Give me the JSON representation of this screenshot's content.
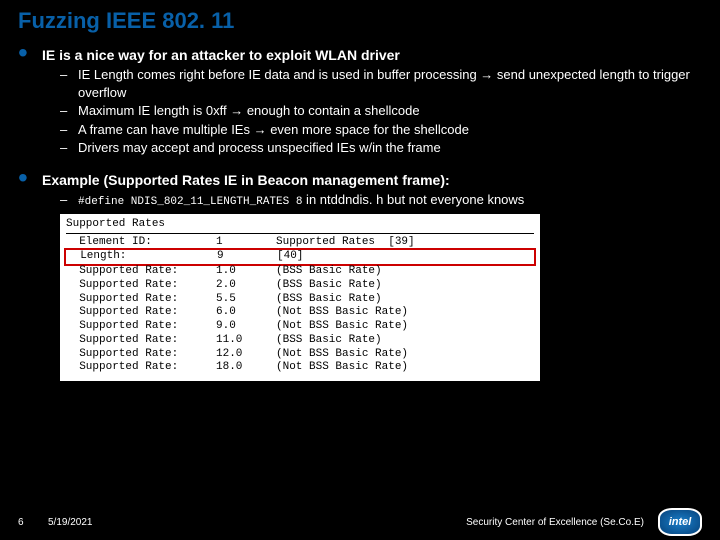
{
  "title": "Fuzzing IEEE 802. 11",
  "bullet1": {
    "text": "IE is a nice way for an attacker to exploit WLAN driver",
    "subs": [
      "IE Length comes right before IE data and is used in buffer processing → send unexpected length to trigger overflow",
      "Maximum IE length is 0xff → enough to contain a shellcode",
      "A frame can have multiple IEs → even more space for the shellcode",
      "Drivers may accept and process unspecified IEs w/in the frame"
    ]
  },
  "bullet2": {
    "text": "Example (Supported Rates IE in Beacon management frame):",
    "sub_code": "#define NDIS_802_11_LENGTH_RATES 8",
    "sub_rest": " in ntddndis. h but not everyone knows"
  },
  "table": {
    "header": "Supported Rates",
    "rows": [
      {
        "label": "Element ID:",
        "val": "1",
        "desc": "Supported Rates  [39]"
      },
      {
        "label": "Length:",
        "val": "9",
        "desc": "[40]"
      },
      {
        "label": "Supported Rate:",
        "val": "1.0",
        "desc": "(BSS Basic Rate)"
      },
      {
        "label": "Supported Rate:",
        "val": "2.0",
        "desc": "(BSS Basic Rate)"
      },
      {
        "label": "Supported Rate:",
        "val": "5.5",
        "desc": "(BSS Basic Rate)"
      },
      {
        "label": "Supported Rate:",
        "val": "6.0",
        "desc": "(Not BSS Basic Rate)"
      },
      {
        "label": "Supported Rate:",
        "val": "9.0",
        "desc": "(Not BSS Basic Rate)"
      },
      {
        "label": "Supported Rate:",
        "val": "11.0",
        "desc": "(BSS Basic Rate)"
      },
      {
        "label": "Supported Rate:",
        "val": "12.0",
        "desc": "(Not BSS Basic Rate)"
      },
      {
        "label": "Supported Rate:",
        "val": "18.0",
        "desc": "(Not BSS Basic Rate)"
      }
    ],
    "highlight_index": 1
  },
  "footer": {
    "page": "6",
    "date": "5/19/2021",
    "org": "Security Center of Excellence (Se.Co.E)",
    "logo": "intel"
  }
}
